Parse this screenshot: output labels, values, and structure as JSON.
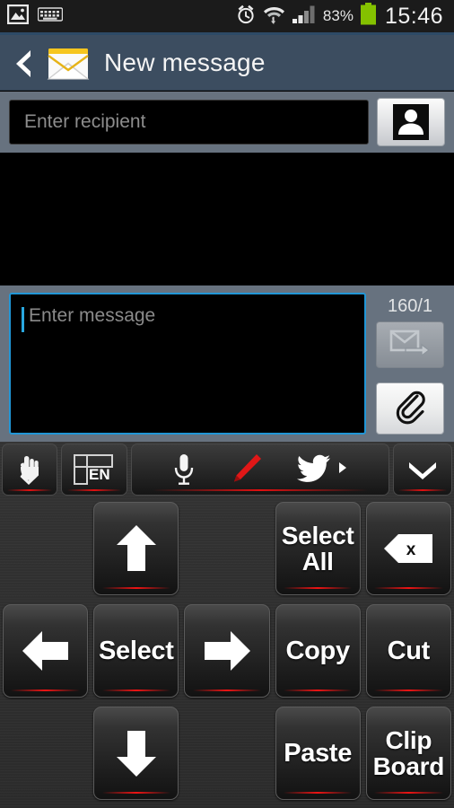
{
  "status_bar": {
    "left_icons": [
      {
        "name": "gallery-image-icon",
        "glyph": "image"
      },
      {
        "name": "keyboard-notification-icon",
        "glyph": "keyboard"
      }
    ],
    "right_icons": [
      {
        "name": "alarm-icon",
        "glyph": "alarm"
      },
      {
        "name": "wifi-icon",
        "glyph": "wifi"
      },
      {
        "name": "signal-icon",
        "glyph": "signal"
      }
    ],
    "battery_percent": "83%",
    "battery_color": "#84c100",
    "clock": "15:46"
  },
  "title_bar": {
    "back_label": "back-chevron",
    "app_icon": "envelope-icon",
    "title": "New message",
    "background": "#3c4d60"
  },
  "recipient": {
    "placeholder": "Enter recipient",
    "value": "",
    "contacts_button": "contacts-picker-button"
  },
  "compose": {
    "placeholder": "Enter message",
    "value": "",
    "char_counter": "160/1",
    "send_button": "send-message-button",
    "send_enabled": false,
    "attach_button": "attach-button",
    "focus_border_color": "#2196d6"
  },
  "keyboard": {
    "toolbar": {
      "gesture_key": "handwriting-gesture-key",
      "language_key": "EN",
      "shortcuts": [
        {
          "name": "voice-input-icon",
          "glyph": "microphone"
        },
        {
          "name": "handwriting-pen-icon",
          "glyph": "pencil"
        },
        {
          "name": "twitter-icon",
          "glyph": "twitter"
        }
      ],
      "more_arrow": "more-shortcuts-arrow",
      "collapse_key": "hide-keyboard-key"
    },
    "rows": [
      [
        {
          "name": "empty",
          "type": "empty",
          "label": ""
        },
        {
          "name": "arrow-up-key",
          "type": "icon",
          "icon": "arrow-up",
          "label": ""
        },
        {
          "name": "empty",
          "type": "empty",
          "label": ""
        },
        {
          "name": "select-all-key",
          "type": "text",
          "label": "Select\nAll"
        },
        {
          "name": "backspace-key",
          "type": "icon",
          "icon": "backspace",
          "label": ""
        }
      ],
      [
        {
          "name": "arrow-left-key",
          "type": "icon",
          "icon": "arrow-left",
          "label": ""
        },
        {
          "name": "select-key",
          "type": "text",
          "label": "Select"
        },
        {
          "name": "arrow-right-key",
          "type": "icon",
          "icon": "arrow-right",
          "label": ""
        },
        {
          "name": "copy-key",
          "type": "text",
          "label": "Copy"
        },
        {
          "name": "cut-key",
          "type": "text",
          "label": "Cut"
        }
      ],
      [
        {
          "name": "empty",
          "type": "empty",
          "label": ""
        },
        {
          "name": "arrow-down-key",
          "type": "icon",
          "icon": "arrow-down",
          "label": ""
        },
        {
          "name": "empty",
          "type": "empty",
          "label": ""
        },
        {
          "name": "paste-key",
          "type": "text",
          "label": "Paste"
        },
        {
          "name": "clipboard-key",
          "type": "text",
          "label": "Clip\nBoard"
        }
      ]
    ]
  }
}
